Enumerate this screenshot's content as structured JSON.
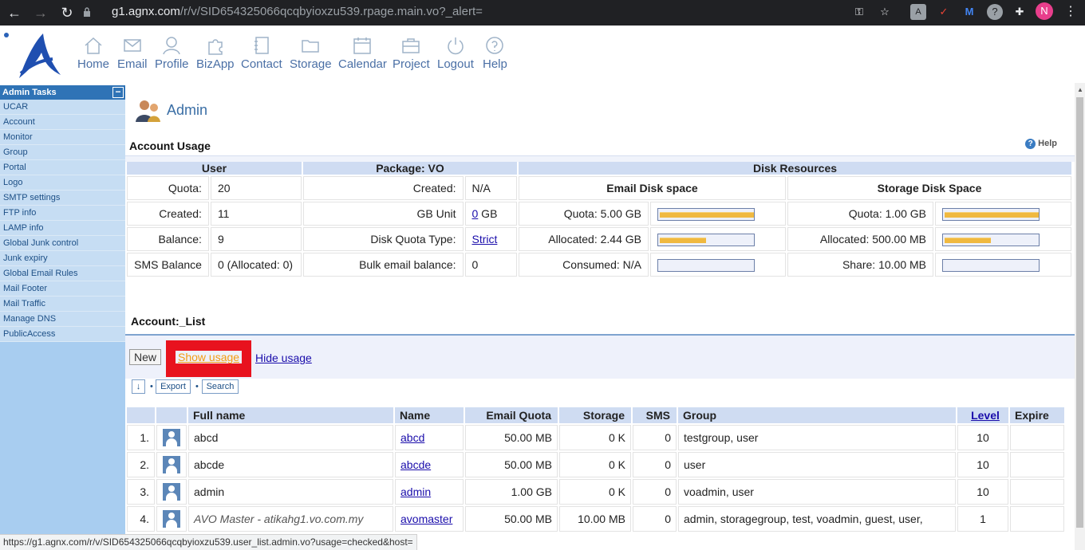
{
  "browser": {
    "url_host": "g1.agnx.com",
    "url_path": "/r/v/SID654325066qcqbyioxzu539.rpage.main.vo?_alert=",
    "avatar_letter": "N"
  },
  "topnav": [
    {
      "label": "Home"
    },
    {
      "label": "Email"
    },
    {
      "label": "Profile"
    },
    {
      "label": "BizApp"
    },
    {
      "label": "Contact"
    },
    {
      "label": "Storage"
    },
    {
      "label": "Calendar"
    },
    {
      "label": "Project"
    },
    {
      "label": "Logout"
    },
    {
      "label": "Help"
    }
  ],
  "sidebar": {
    "title": "Admin Tasks",
    "collapse": "−",
    "items": [
      "UCAR",
      "Account",
      "Monitor",
      "Group",
      "Portal",
      "Logo",
      "SMTP settings",
      "FTP info",
      "LAMP info",
      "Global Junk control",
      "Junk expiry",
      "Global Email Rules",
      "Mail Footer",
      "Mail Traffic",
      "Manage DNS",
      "PublicAccess"
    ]
  },
  "page": {
    "title": "Admin",
    "help": "Help"
  },
  "usage": {
    "title": "Account Usage",
    "headers": {
      "user": "User",
      "package": "Package: VO",
      "disk": "Disk Resources",
      "email_disk": "Email Disk space",
      "storage_disk": "Storage Disk Space"
    },
    "user_rows": [
      {
        "label": "Quota:",
        "value": "20"
      },
      {
        "label": "Created:",
        "value": "11"
      },
      {
        "label": "Balance:",
        "value": "9"
      },
      {
        "label": "SMS Balance",
        "value": "0 (Allocated: 0)"
      }
    ],
    "package_rows": [
      {
        "label": "Created:",
        "value": "N/A"
      },
      {
        "label": "GB Unit",
        "value_link": "0",
        "value_suffix": " GB"
      },
      {
        "label": "Disk Quota Type:",
        "value_link": "Strict"
      },
      {
        "label": "Bulk email balance:",
        "value": "0"
      }
    ],
    "email_rows": [
      {
        "label": "Quota: 5.00 GB",
        "level": 1.0
      },
      {
        "label": "Allocated: 2.44 GB",
        "level": 0.49
      },
      {
        "label": "Consumed: N/A",
        "level": 0
      }
    ],
    "storage_rows": [
      {
        "label": "Quota: 1.00 GB",
        "level": 1.0
      },
      {
        "label": "Allocated: 500.00 MB",
        "level": 0.49
      },
      {
        "label": "Share: 10.00 MB",
        "level": 0
      }
    ]
  },
  "account_list": {
    "title": "Account:_List",
    "new": "New",
    "show_usage": "Show usage",
    "hide_usage": "Hide usage",
    "sort_icon": "↓",
    "export": "Export",
    "search": "Search",
    "columns": [
      "",
      "",
      "Full name",
      "Name",
      "Email Quota",
      "Storage",
      "SMS",
      "Group",
      "Level",
      "Expire"
    ],
    "rows": [
      {
        "num": "1.",
        "fullname": "abcd",
        "name": "abcd",
        "email_quota": "50.00 MB",
        "storage": "0 K",
        "sms": "0",
        "group": "testgroup, user",
        "level": "10",
        "expire": ""
      },
      {
        "num": "2.",
        "fullname": "abcde",
        "name": "abcde",
        "email_quota": "50.00 MB",
        "storage": "0 K",
        "sms": "0",
        "group": "user",
        "level": "10",
        "expire": ""
      },
      {
        "num": "3.",
        "fullname": "admin",
        "name": "admin",
        "email_quota": "1.00 GB",
        "storage": "0 K",
        "sms": "0",
        "group": "voadmin, user",
        "level": "10",
        "expire": ""
      },
      {
        "num": "4.",
        "fullname": "AVO Master - atikahg1.vo.com.my",
        "name": "avomaster",
        "email_quota": "50.00 MB",
        "storage": "10.00 MB",
        "sms": "0",
        "group": "admin, storagegroup, test, voadmin, guest, user,",
        "level": "1",
        "expire": ""
      }
    ]
  },
  "status_url": "https://g1.agnx.com/r/v/SID654325066qcqbyioxzu539.user_list.admin.vo?usage=checked&host="
}
